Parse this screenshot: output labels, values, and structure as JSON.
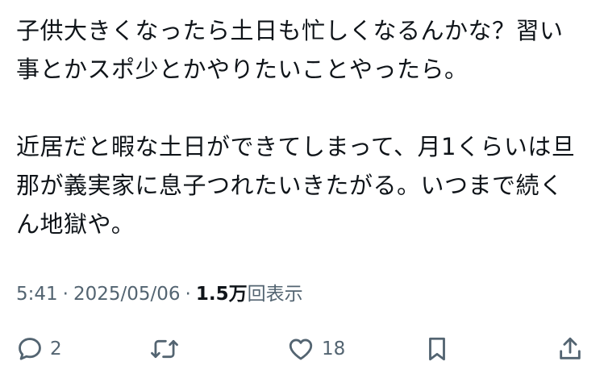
{
  "tweet": {
    "lines": [
      "子供大きくなったら土日も忙しくなるんかな？習い",
      "事とかスポ少とかやりたいことやったら。",
      "",
      "近居だと暇な土日ができてしまって、月1くらいは旦",
      "那が義実家に息子つれたいきたがる。いつまで続く",
      "ん地獄や。"
    ]
  },
  "meta": {
    "time": "5:41",
    "separator": "·",
    "date": "2025/05/06",
    "views_count": "1.5万",
    "views_label": "回表示"
  },
  "actions": {
    "reply_count": "2",
    "retweet_count": "",
    "like_count": "18"
  },
  "icons": {
    "reply": "reply-bubble-icon",
    "retweet": "retweet-arrows-icon",
    "like": "heart-icon",
    "bookmark": "bookmark-icon",
    "share": "share-upload-icon"
  },
  "colors": {
    "text": "#0f1419",
    "secondary": "#536471",
    "background": "#ffffff"
  }
}
